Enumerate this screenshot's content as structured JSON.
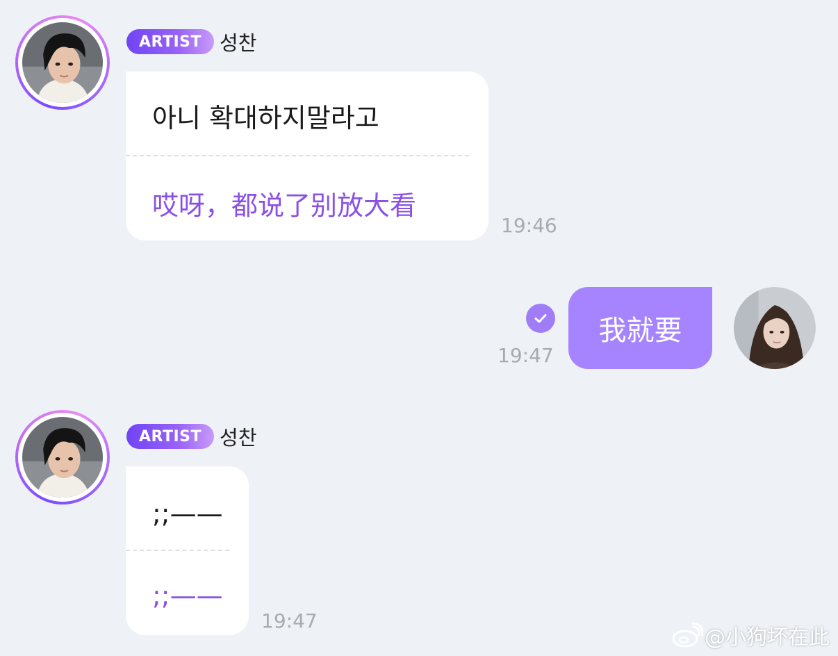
{
  "colors": {
    "background": "#eef2f6",
    "badge_gradient_start": "#6f44f4",
    "badge_gradient_end": "#c79bf8",
    "translation_text": "#8a50e6",
    "my_bubble": "#a784ff",
    "timestamp": "#a7abb1"
  },
  "messages": [
    {
      "sender_badge": "ARTIST",
      "sender_name": "성찬",
      "original_text": "아니 확대하지말라고",
      "translated_text": "哎呀，都说了别放大看",
      "time": "19:46"
    },
    {
      "sender": "me",
      "text": "我就要",
      "time": "19:47",
      "read_icon": "checkmark-circle-icon"
    },
    {
      "sender_badge": "ARTIST",
      "sender_name": "성찬",
      "original_text": ";;——",
      "translated_text": ";;——",
      "time": "19:47"
    }
  ],
  "watermark": {
    "icon": "weibo-icon",
    "text": "@小狗坏在此"
  }
}
